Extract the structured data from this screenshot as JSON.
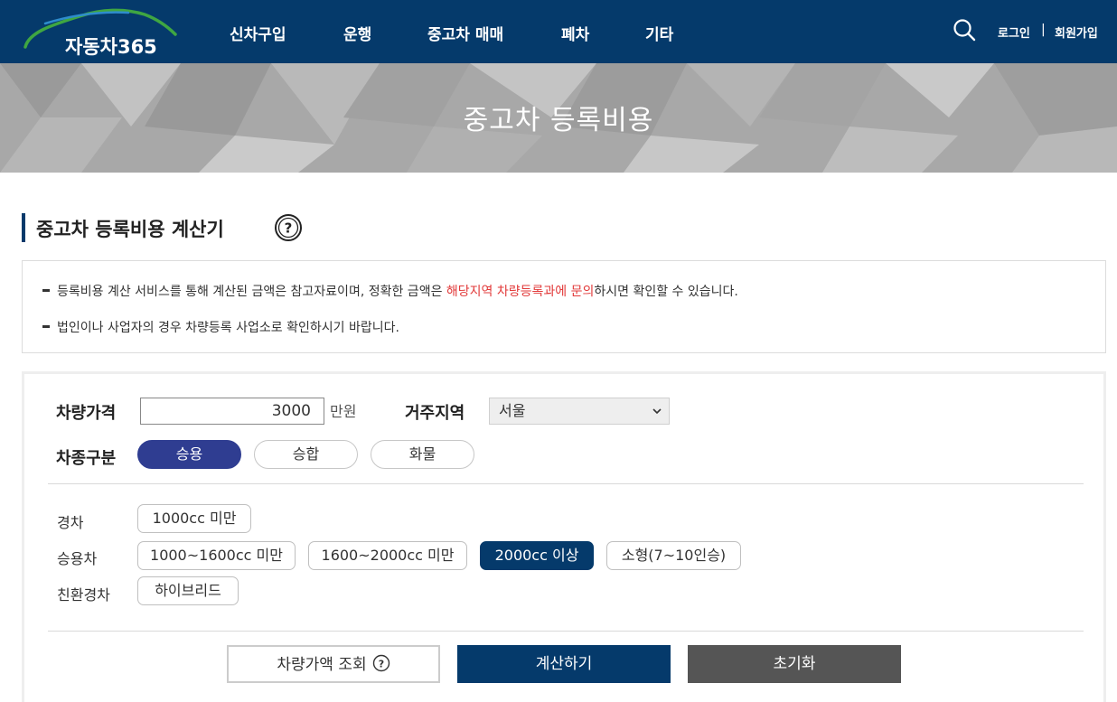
{
  "header": {
    "logo_text": "자동차365",
    "nav": [
      "신차구입",
      "운행",
      "중고차 매매",
      "폐차",
      "기타"
    ],
    "login": "로그인",
    "separator": "|",
    "signup": "회원가입",
    "search_icon": "search-icon"
  },
  "hero": {
    "title": "중고차 등록비용"
  },
  "section": {
    "title": "중고차 등록비용 계산기",
    "help_icon": "question-circle-icon"
  },
  "notice": {
    "line1_pre": "등록비용 계산 서비스를 통해 계산된 금액은 참고자료이며, 정확한 금액은 ",
    "line1_red": "해당지역 차량등록과에 문의",
    "line1_post": "하시면 확인할 수 있습니다.",
    "line2": "법인이나 사업자의 경우 차량등록 사업소로 확인하시기 바랍니다."
  },
  "form": {
    "price_label": "차량가격",
    "price_value": "3000",
    "price_unit": "만원",
    "region_label": "거주지역",
    "region_selected": "서울",
    "type_label": "차종구분",
    "types": [
      {
        "label": "승용",
        "active": true
      },
      {
        "label": "승합",
        "active": false
      },
      {
        "label": "화물",
        "active": false
      }
    ],
    "categories": [
      {
        "label": "경차",
        "options": [
          {
            "label": "1000cc 미만",
            "active": false
          }
        ]
      },
      {
        "label": "승용차",
        "options": [
          {
            "label": "1000~1600cc 미만",
            "active": false
          },
          {
            "label": "1600~2000cc 미만",
            "active": false
          },
          {
            "label": "2000cc 이상",
            "active": true
          },
          {
            "label": "소형(7~10인승)",
            "active": false
          }
        ]
      },
      {
        "label": "친환경차",
        "options": [
          {
            "label": "하이브리드",
            "active": false
          }
        ]
      }
    ]
  },
  "buttons": {
    "lookup": "차량가액 조회",
    "calculate": "계산하기",
    "reset": "초기화"
  },
  "colors": {
    "header_bg": "#053a6b",
    "active_type": "#2f3d91",
    "active_chip": "#053a6b",
    "notice_red": "#e23a3a",
    "reset_bg": "#555555"
  }
}
